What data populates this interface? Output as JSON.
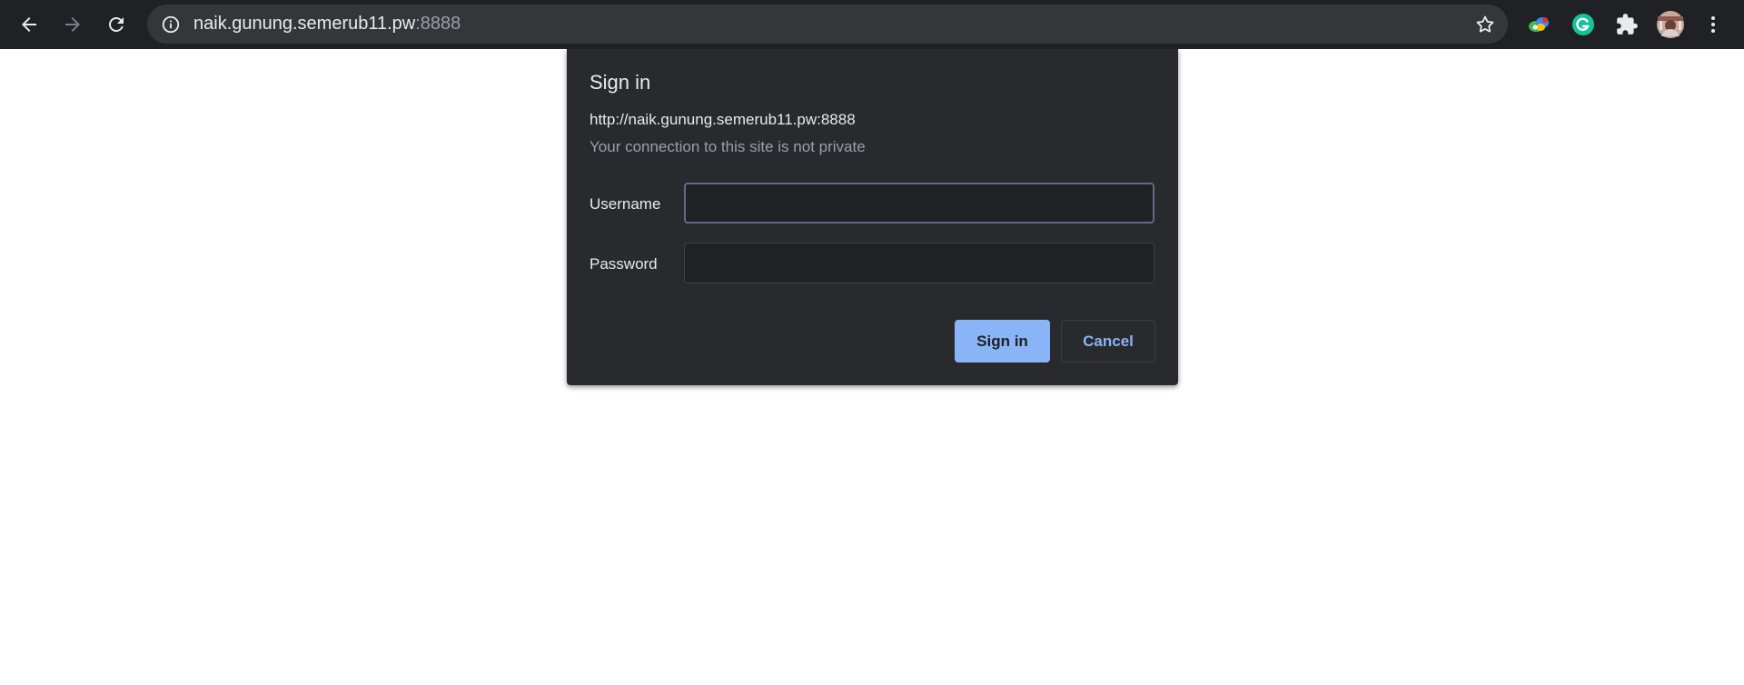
{
  "browser": {
    "url_host": "naik.gunung.semerub11.pw",
    "url_port": ":8888",
    "icons": {
      "back": "arrow-left-icon",
      "forward": "arrow-right-icon",
      "reload": "reload-icon",
      "site_info": "info-icon",
      "bookmark": "star-icon",
      "extensions": "puzzle-icon",
      "menu": "more-vert-icon"
    }
  },
  "dialog": {
    "title": "Sign in",
    "origin": "http://naik.gunung.semerub11.pw:8888",
    "warning": "Your connection to this site is not private",
    "username_label": "Username",
    "username_value": "",
    "password_label": "Password",
    "password_value": "",
    "sign_in_button": "Sign in",
    "cancel_button": "Cancel"
  },
  "colors": {
    "toolbar_bg": "#202124",
    "omnibox_bg": "#35363a",
    "dialog_bg": "#292a2d",
    "accent": "#8ab4f8",
    "grammarly": "#15c39a"
  }
}
